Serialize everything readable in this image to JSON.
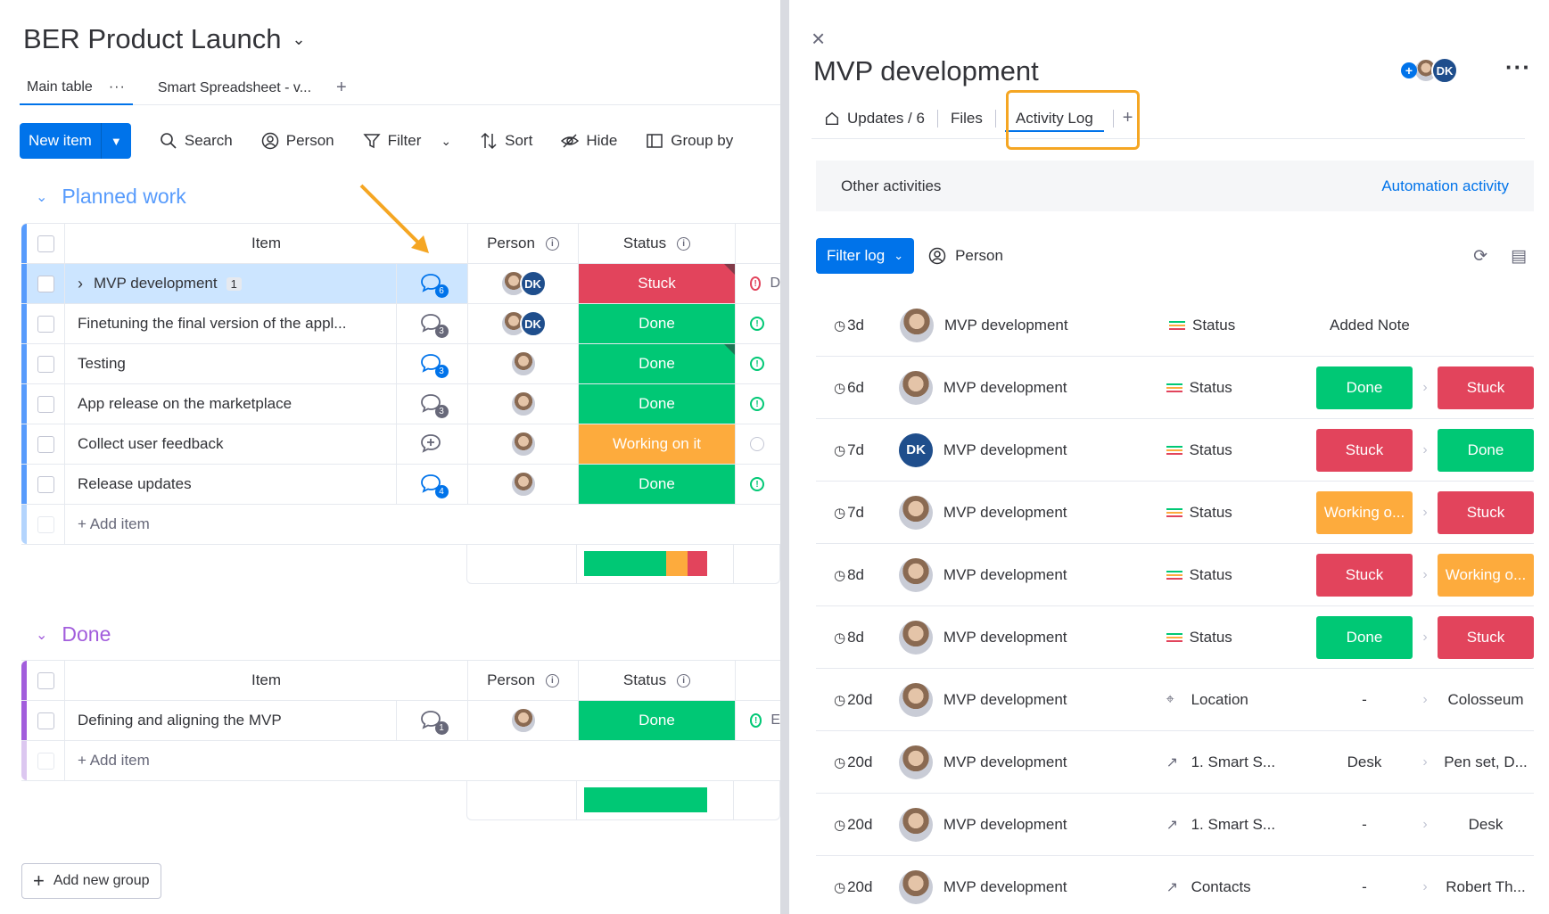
{
  "board": {
    "title": "BER Product Launch",
    "views": [
      {
        "label": "Main table",
        "more": "···"
      },
      {
        "label": "Smart Spreadsheet - v..."
      }
    ],
    "add_view": "+",
    "toolbar": {
      "new_item": "New item",
      "search": "Search",
      "person": "Person",
      "filter": "Filter",
      "sort": "Sort",
      "hide": "Hide",
      "group_by": "Group by"
    },
    "columns": {
      "item": "Item",
      "person": "Person",
      "status": "Status"
    },
    "groups": [
      {
        "name": "Planned work",
        "color": "#579bfc",
        "rows": [
          {
            "item": "MVP development",
            "subitems": "1",
            "updates": "6",
            "status": "Stuck",
            "status_color": "#e2445c",
            "extra": "D"
          },
          {
            "item": "Finetuning the final version of the appl...",
            "updates": "3",
            "status": "Done",
            "status_color": "#00c875"
          },
          {
            "item": "Testing",
            "updates": "3",
            "status": "Done",
            "status_color": "#00c875"
          },
          {
            "item": "App release on the marketplace",
            "updates": "3",
            "status": "Done",
            "status_color": "#00c875"
          },
          {
            "item": "Collect user feedback",
            "updates": "",
            "status": "Working on it",
            "status_color": "#fdab3d"
          },
          {
            "item": "Release updates",
            "updates": "4",
            "status": "Done",
            "status_color": "#00c875"
          }
        ],
        "add_item": "+ Add item"
      },
      {
        "name": "Done",
        "color": "#a25ddc",
        "rows": [
          {
            "item": "Defining and aligning the MVP",
            "updates": "1",
            "status": "Done",
            "status_color": "#00c875",
            "extra": "E"
          }
        ],
        "add_item": "+ Add item"
      }
    ],
    "add_group": "Add new group"
  },
  "panel": {
    "close": "×",
    "title": "MVP development",
    "avatar_initials": "DK",
    "more": "···",
    "tabs": {
      "updates": "Updates / 6",
      "files": "Files",
      "activity": "Activity Log",
      "add": "+"
    },
    "subnav": {
      "other": "Other activities",
      "automation": "Automation activity"
    },
    "filter_log": "Filter log",
    "person": "Person",
    "log": [
      {
        "time": "3d",
        "user": "avatar",
        "item": "MVP development",
        "column": "Status",
        "col_icon": "status",
        "note": "Added Note"
      },
      {
        "time": "6d",
        "user": "avatar",
        "item": "MVP development",
        "column": "Status",
        "col_icon": "status",
        "from": "Done",
        "from_color": "#00c875",
        "to": "Stuck",
        "to_color": "#e2445c"
      },
      {
        "time": "7d",
        "user": "DK",
        "item": "MVP development",
        "column": "Status",
        "col_icon": "status",
        "from": "Stuck",
        "from_color": "#e2445c",
        "to": "Done",
        "to_color": "#00c875"
      },
      {
        "time": "7d",
        "user": "avatar",
        "item": "MVP development",
        "column": "Status",
        "col_icon": "status",
        "from": "Working o...",
        "from_color": "#fdab3d",
        "to": "Stuck",
        "to_color": "#e2445c"
      },
      {
        "time": "8d",
        "user": "avatar",
        "item": "MVP development",
        "column": "Status",
        "col_icon": "status",
        "from": "Stuck",
        "from_color": "#e2445c",
        "to": "Working o...",
        "to_color": "#fdab3d"
      },
      {
        "time": "8d",
        "user": "avatar",
        "item": "MVP development",
        "column": "Status",
        "col_icon": "status",
        "from": "Done",
        "from_color": "#00c875",
        "to": "Stuck",
        "to_color": "#e2445c"
      },
      {
        "time": "20d",
        "user": "avatar",
        "item": "MVP development",
        "column": "Location",
        "col_icon": "location",
        "from": "-",
        "to": "Colosseum"
      },
      {
        "time": "20d",
        "user": "avatar",
        "item": "MVP development",
        "column": "1. Smart S...",
        "col_icon": "link",
        "from": "Desk",
        "to": "Pen set, D..."
      },
      {
        "time": "20d",
        "user": "avatar",
        "item": "MVP development",
        "column": "1. Smart S...",
        "col_icon": "link",
        "from": "-",
        "to": "Desk"
      },
      {
        "time": "20d",
        "user": "avatar",
        "item": "MVP development",
        "column": "Contacts",
        "col_icon": "link",
        "from": "-",
        "to": "Robert Th..."
      }
    ]
  },
  "colors": {
    "accent": "#0073ea",
    "highlight": "#f5a623"
  }
}
